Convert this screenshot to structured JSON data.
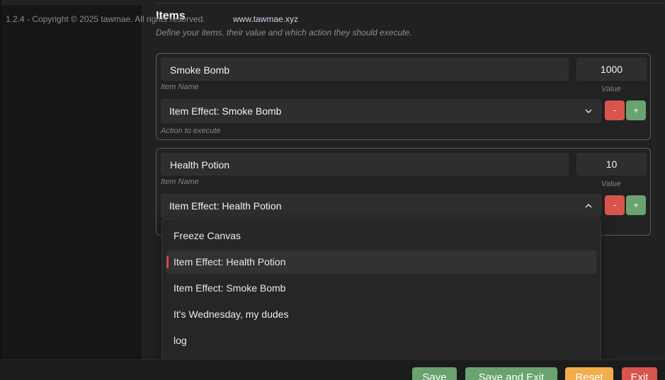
{
  "section": {
    "title": "Items",
    "description": "Define your items, their value and which action they should execute."
  },
  "items": [
    {
      "name": "Smoke Bomb",
      "name_hint": "Item Name",
      "value": "1000",
      "value_hint": "Value",
      "action": "Item Effect: Smoke Bomb",
      "action_hint": "Action to execute",
      "minus_label": "-",
      "plus_label": "+",
      "dropdown_open": false
    },
    {
      "name": "Health Potion",
      "name_hint": "Item Name",
      "value": "10",
      "value_hint": "Value",
      "action": "Item Effect: Health Potion",
      "minus_label": "-",
      "plus_label": "+",
      "dropdown_open": true
    }
  ],
  "dropdown": {
    "options": [
      "Freeze Canvas",
      "Item Effect: Health Potion",
      "Item Effect: Smoke Bomb",
      "It's Wednesday, my dudes",
      "log"
    ],
    "selected_index": 1
  },
  "icons": {
    "select_closed": "chevron-down-icon",
    "select_open": "chevron-up-icon"
  },
  "footer": {
    "copyright": "1.2.4 - Copyright © 2025 tawmae. All rights reserved.",
    "link": "www.tawmae.xyz",
    "buttons": {
      "save": "Save",
      "save_exit": "Save and Exit",
      "reset": "Reset",
      "exit": "Exit"
    }
  },
  "colors": {
    "danger": "#d9534f",
    "success": "#6aa36f",
    "warning": "#f3ad4d",
    "selected_marker": "#d9434f"
  }
}
